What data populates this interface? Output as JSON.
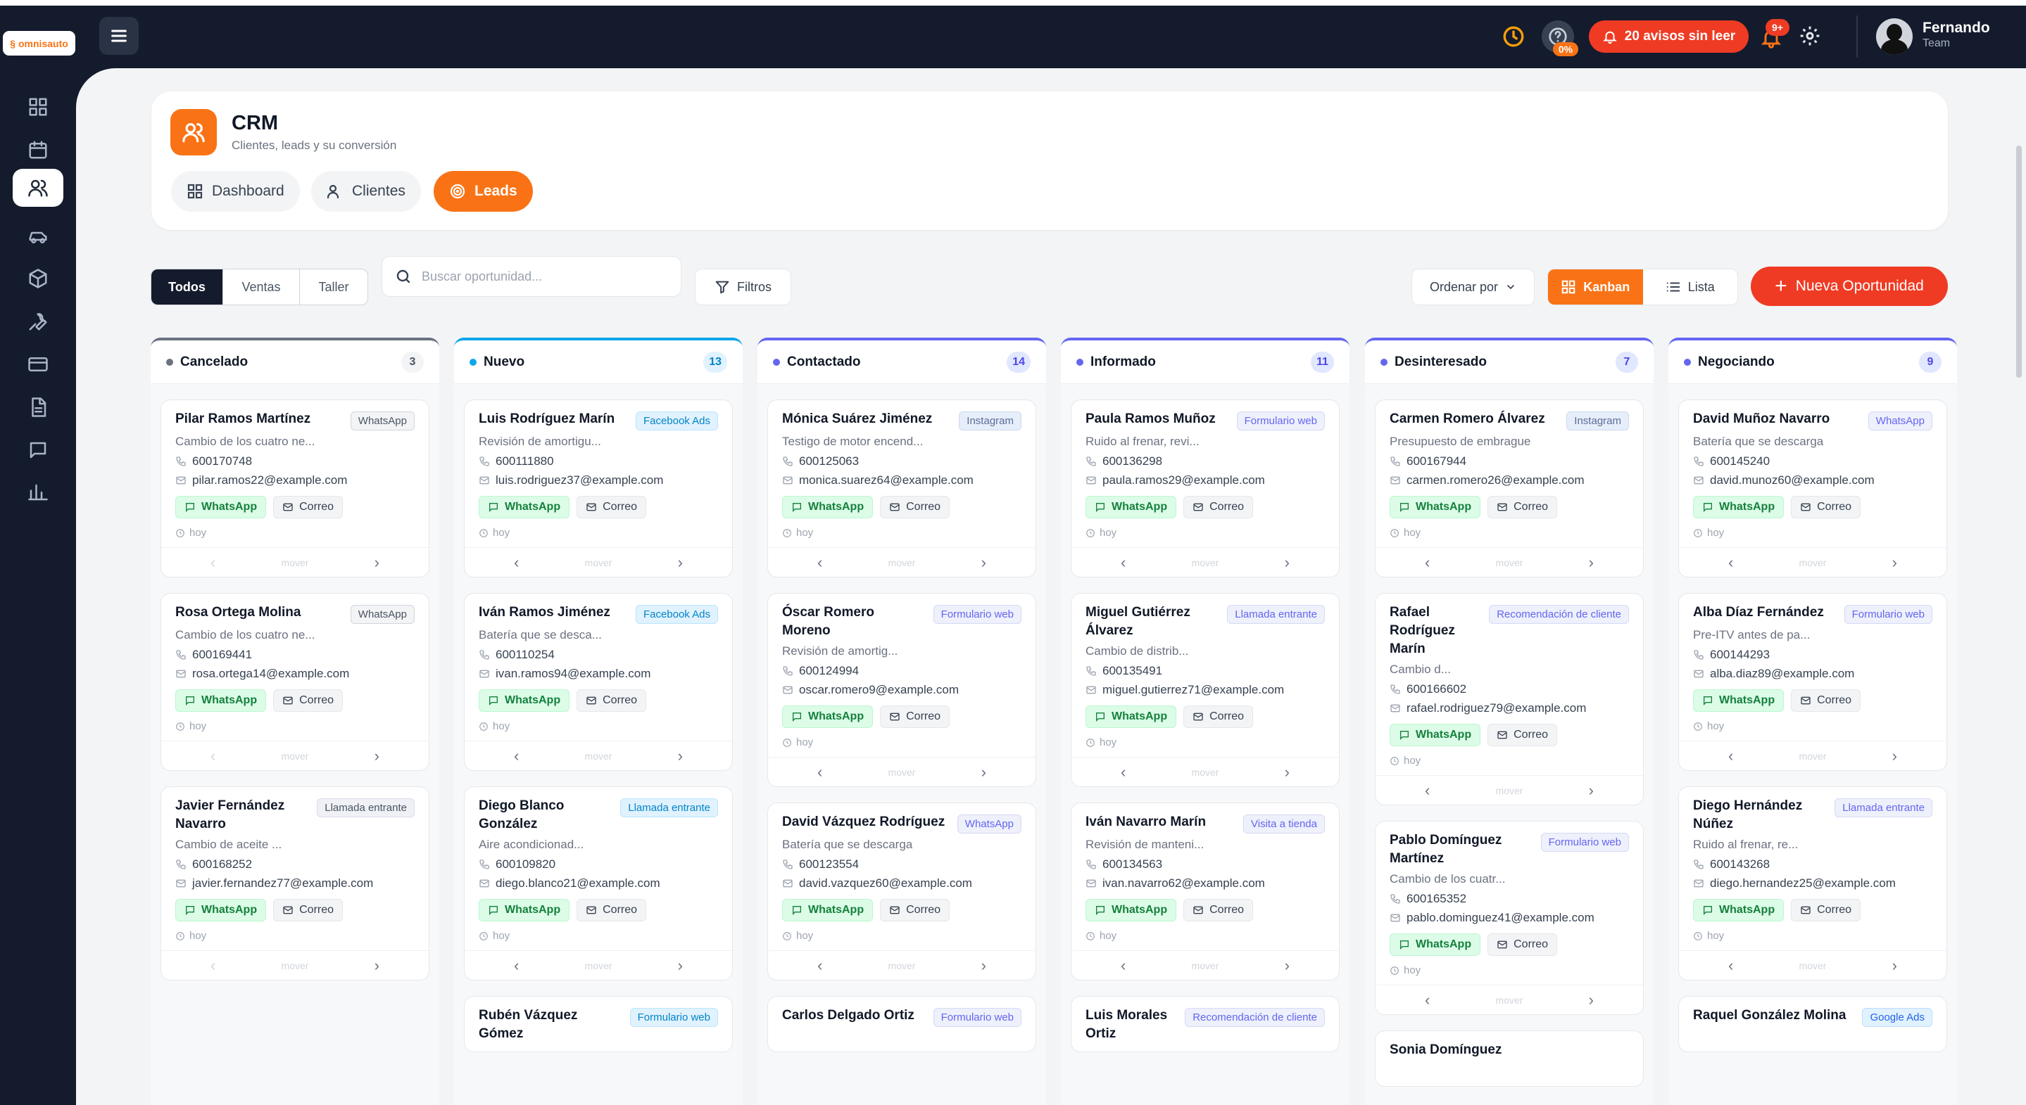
{
  "app": {
    "logo_text": "omnisauto",
    "user_name": "Fernando",
    "user_role": "Team",
    "help_badge": "0%",
    "alerts_label": "20 avisos sin leer",
    "notif_badge": "9+"
  },
  "sidebar": [
    "dashboard-icon",
    "calendar-icon",
    "users-icon",
    "car-icon",
    "box-icon",
    "wrench-icon",
    "card-icon",
    "document-icon",
    "chat-icon",
    "chart-icon"
  ],
  "header": {
    "title": "CRM",
    "subtitle": "Clientes, leads y su conversión",
    "tabs": [
      "Dashboard",
      "Clientes",
      "Leads"
    ],
    "active_tab": "Leads"
  },
  "toolbar": {
    "segments": [
      "Todos",
      "Ventas",
      "Taller"
    ],
    "search_placeholder": "Buscar oportunidad...",
    "filters": "Filtros",
    "order": "Ordenar por",
    "kanban": "Kanban",
    "list": "Lista",
    "new": "Nueva Oportunidad"
  },
  "labels": {
    "whatsapp": "WhatsApp",
    "mail": "Correo",
    "time": "hoy",
    "move": "mover"
  },
  "colors": {
    "accent": "#f97316",
    "danger": "#ef3b24",
    "dark": "#141b2d"
  },
  "columns": [
    {
      "name": "Cancelado",
      "count": "3",
      "color": "#6b7280",
      "badge_bg": "#f3f4f6",
      "badge_fg": "#4b5563",
      "first": true,
      "cards": [
        {
          "name": "Pilar Ramos Martínez",
          "source": "WhatsApp",
          "src": "wa",
          "desc": "Cambio de los cuatro ne...",
          "phone": "600170748",
          "email": "pilar.ramos22@example.com"
        },
        {
          "name": "Rosa Ortega Molina",
          "source": "WhatsApp",
          "src": "wa",
          "desc": "Cambio de los cuatro ne...",
          "phone": "600169441",
          "email": "rosa.ortega14@example.com"
        },
        {
          "name": "Javier Fernández Navarro",
          "source": "Llamada entrante",
          "src": "call",
          "desc": "Cambio de aceite ...",
          "phone": "600168252",
          "email": "javier.fernandez77@example.com"
        }
      ]
    },
    {
      "name": "Nuevo",
      "count": "13",
      "color": "#0ea5e9",
      "badge_bg": "#e0f2fe",
      "badge_fg": "#0284c7",
      "first": false,
      "cards": [
        {
          "name": "Luis Rodríguez Marín",
          "source": "Facebook Ads",
          "src": "fb",
          "desc": "Revisión de amortigu...",
          "phone": "600111880",
          "email": "luis.rodriguez37@example.com"
        },
        {
          "name": "Iván Ramos Jiménez",
          "source": "Facebook Ads",
          "src": "fb",
          "desc": "Batería que se desca...",
          "phone": "600110254",
          "email": "ivan.ramos94@example.com"
        },
        {
          "name": "Diego Blanco González",
          "source": "Llamada entrante",
          "src": "fb",
          "desc": "Aire acondicionad...",
          "phone": "600109820",
          "email": "diego.blanco21@example.com"
        },
        {
          "name": "Rubén Vázquez Gómez",
          "source": "Formulario web",
          "src": "fb",
          "desc": "",
          "phone": "",
          "email": ""
        }
      ]
    },
    {
      "name": "Contactado",
      "count": "14",
      "color": "#6366f1",
      "badge_bg": "#e0e7ff",
      "badge_fg": "#4f46e5",
      "first": false,
      "cards": [
        {
          "name": "Mónica Suárez Jiménez",
          "source": "Instagram",
          "src": "ig",
          "desc": "Testigo de motor encend...",
          "phone": "600125063",
          "email": "monica.suarez64@example.com"
        },
        {
          "name": "Óscar Romero Moreno",
          "source": "Formulario web",
          "src": "fw",
          "desc": "Revisión de amortig...",
          "phone": "600124994",
          "email": "oscar.romero9@example.com"
        },
        {
          "name": "David Vázquez Rodríguez",
          "source": "WhatsApp",
          "src": "fw",
          "desc": "Batería que se descarga",
          "phone": "600123554",
          "email": "david.vazquez60@example.com"
        },
        {
          "name": "Carlos Delgado Ortiz",
          "source": "Formulario web",
          "src": "fw",
          "desc": "",
          "phone": "",
          "email": ""
        }
      ]
    },
    {
      "name": "Informado",
      "count": "11",
      "color": "#6366f1",
      "badge_bg": "#e0e7ff",
      "badge_fg": "#4f46e5",
      "first": false,
      "cards": [
        {
          "name": "Paula Ramos Muñoz",
          "source": "Formulario web",
          "src": "fw",
          "desc": "Ruido al frenar, revi...",
          "phone": "600136298",
          "email": "paula.ramos29@example.com"
        },
        {
          "name": "Miguel Gutiérrez Álvarez",
          "source": "Llamada entrante",
          "src": "fw",
          "desc": "Cambio de distrib...",
          "phone": "600135491",
          "email": "miguel.gutierrez71@example.com"
        },
        {
          "name": "Iván Navarro Marín",
          "source": "Visita a tienda",
          "src": "vis",
          "desc": "Revisión de manteni...",
          "phone": "600134563",
          "email": "ivan.navarro62@example.com"
        },
        {
          "name": "Luis Morales Ortiz",
          "source": "Recomendación de cliente",
          "src": "rec",
          "desc": "",
          "phone": "",
          "email": ""
        }
      ]
    },
    {
      "name": "Desinteresado",
      "count": "7",
      "color": "#6366f1",
      "badge_bg": "#e0e7ff",
      "badge_fg": "#4f46e5",
      "first": false,
      "cards": [
        {
          "name": "Carmen Romero Álvarez",
          "source": "Instagram",
          "src": "ig",
          "desc": "Presupuesto de embrague",
          "phone": "600167944",
          "email": "carmen.romero26@example.com"
        },
        {
          "name": "Rafael Rodríguez Marín",
          "source": "Recomendación de cliente",
          "src": "rec",
          "desc": "Cambio d...",
          "phone": "600166602",
          "email": "rafael.rodriguez79@example.com"
        },
        {
          "name": "Pablo Domínguez Martínez",
          "source": "Formulario web",
          "src": "fw",
          "desc": "Cambio de los cuatr...",
          "phone": "600165352",
          "email": "pablo.dominguez41@example.com"
        },
        {
          "name": "Sonia Domínguez",
          "source": "",
          "src": "fw",
          "desc": "",
          "phone": "",
          "email": ""
        }
      ]
    },
    {
      "name": "Negociando",
      "count": "9",
      "color": "#6366f1",
      "badge_bg": "#e0e7ff",
      "badge_fg": "#4f46e5",
      "first": false,
      "cards": [
        {
          "name": "David Muñoz Navarro",
          "source": "WhatsApp",
          "src": "fw",
          "desc": "Batería que se descarga",
          "phone": "600145240",
          "email": "david.munoz60@example.com"
        },
        {
          "name": "Alba Díaz Fernández",
          "source": "Formulario web",
          "src": "fw",
          "desc": "Pre-ITV antes de pa...",
          "phone": "600144293",
          "email": "alba.diaz89@example.com"
        },
        {
          "name": "Diego Hernández Núñez",
          "source": "Llamada entrante",
          "src": "fw",
          "desc": "Ruido al frenar, re...",
          "phone": "600143268",
          "email": "diego.hernandez25@example.com"
        },
        {
          "name": "Raquel González Molina",
          "source": "Google Ads",
          "src": "gads",
          "desc": "",
          "phone": "",
          "email": ""
        }
      ]
    }
  ]
}
